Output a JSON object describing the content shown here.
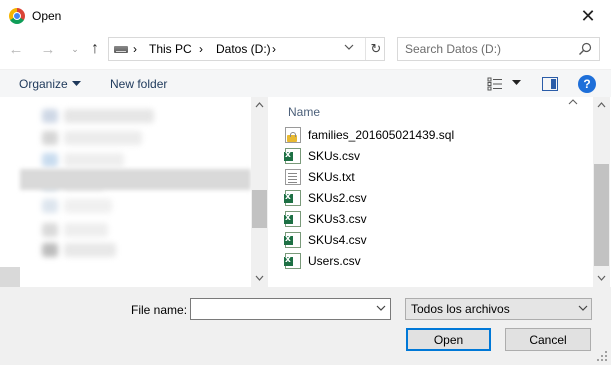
{
  "window": {
    "title": "Open",
    "close_glyph": "✕"
  },
  "address": {
    "separator": "›",
    "crumbs": [
      "This PC",
      "Datos (D:)"
    ],
    "refresh_glyph": "↻"
  },
  "search": {
    "placeholder": "Search Datos (D:)"
  },
  "nav_buttons": {
    "back": "←",
    "forward": "→",
    "recent": "⌄",
    "up": "↑"
  },
  "toolbar": {
    "organize_label": "Organize",
    "new_folder_label": "New folder",
    "help_label": "?"
  },
  "file_list": {
    "column_name": "Name",
    "files": [
      {
        "name": "families_201605021439.sql",
        "icon": "sql-file-icon"
      },
      {
        "name": "SKUs.csv",
        "icon": "excel-csv-icon"
      },
      {
        "name": "SKUs.txt",
        "icon": "text-file-icon"
      },
      {
        "name": "SKUs2.csv",
        "icon": "excel-csv-icon"
      },
      {
        "name": "SKUs3.csv",
        "icon": "excel-csv-icon"
      },
      {
        "name": "SKUs4.csv",
        "icon": "excel-csv-icon"
      },
      {
        "name": "Users.csv",
        "icon": "excel-csv-icon"
      }
    ]
  },
  "bottom": {
    "file_name_label": "File name:",
    "file_name_value": "",
    "file_type_value": "Todos los archivos",
    "open_label": "Open",
    "cancel_label": "Cancel"
  },
  "colors": {
    "accent": "#0078d7",
    "help": "#1e6fd9",
    "toolbar_text": "#1e395b"
  }
}
